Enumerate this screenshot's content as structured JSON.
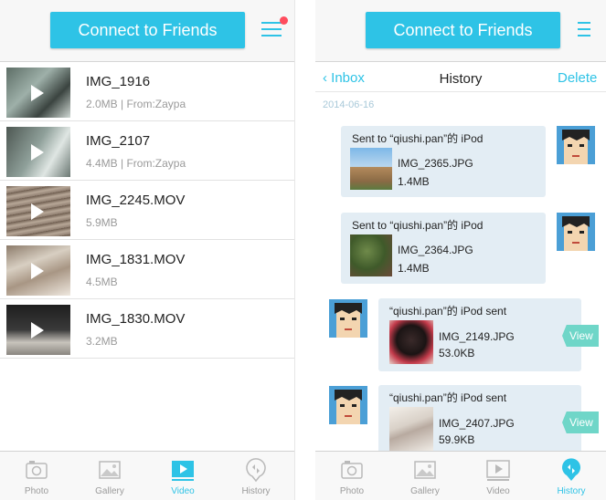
{
  "left": {
    "connect_label": "Connect to Friends",
    "videos": [
      {
        "name": "IMG_1916",
        "meta": "2.0MB | From:Zaypa"
      },
      {
        "name": "IMG_2107",
        "meta": "4.4MB | From:Zaypa"
      },
      {
        "name": "IMG_2245.MOV",
        "meta": "5.9MB"
      },
      {
        "name": "IMG_1831.MOV",
        "meta": "4.5MB"
      },
      {
        "name": "IMG_1830.MOV",
        "meta": "3.2MB"
      }
    ],
    "tabs": [
      {
        "label": "Photo",
        "icon": "photo-icon",
        "active": false
      },
      {
        "label": "Gallery",
        "icon": "gallery-icon",
        "active": false
      },
      {
        "label": "Video",
        "icon": "video-icon",
        "active": true
      },
      {
        "label": "History",
        "icon": "history-icon",
        "active": false
      }
    ]
  },
  "right": {
    "connect_label": "Connect to Friends",
    "nav": {
      "back_label": "Inbox",
      "title": "History",
      "delete_label": "Delete"
    },
    "date": "2014-06-16",
    "messages": [
      {
        "direction": "sent",
        "title": "Sent to “qiushi.pan”的 iPod",
        "file": "IMG_2365.JPG",
        "size": "1.4MB"
      },
      {
        "direction": "sent",
        "title": "Sent to “qiushi.pan”的 iPod",
        "file": "IMG_2364.JPG",
        "size": "1.4MB"
      },
      {
        "direction": "received",
        "title": "“qiushi.pan”的 iPod sent",
        "file": "IMG_2149.JPG",
        "size": "53.0KB",
        "action": "View"
      },
      {
        "direction": "received",
        "title": "“qiushi.pan”的 iPod sent",
        "file": "IMG_2407.JPG",
        "size": "59.9KB",
        "action": "View"
      }
    ],
    "tabs": [
      {
        "label": "Photo",
        "icon": "photo-icon",
        "active": false
      },
      {
        "label": "Gallery",
        "icon": "gallery-icon",
        "active": false
      },
      {
        "label": "Video",
        "icon": "video-icon",
        "active": false
      },
      {
        "label": "History",
        "icon": "history-icon",
        "active": true
      }
    ]
  },
  "colors": {
    "accent": "#2ec3e6",
    "badge": "#ff4d5e",
    "bubble": "#e3edf4",
    "view": "#6fd6c8"
  }
}
